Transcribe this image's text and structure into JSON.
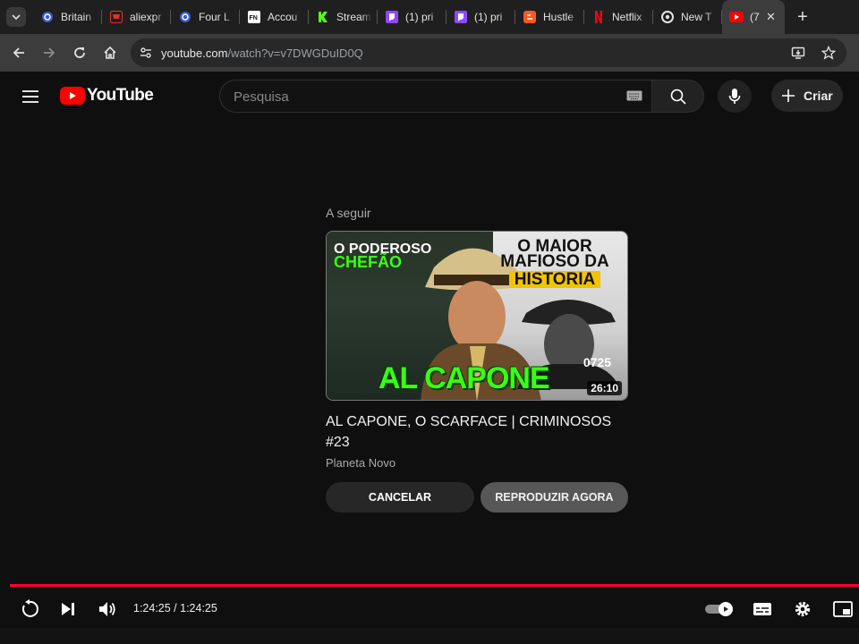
{
  "browser": {
    "tabs": [
      {
        "title": "Britain",
        "icon": "wheel-icon",
        "color": "#9ab8ff"
      },
      {
        "title": "aliexpr",
        "icon": "cart-icon",
        "color": "#e43225"
      },
      {
        "title": "Four L",
        "icon": "wheel-icon",
        "color": "#9ab8ff"
      },
      {
        "title": "Accou",
        "icon": "fn-icon",
        "color": "#ffffff"
      },
      {
        "title": "Stream",
        "icon": "kick-icon",
        "color": "#53fc18"
      },
      {
        "title": "(1) pri",
        "icon": "twitch-icon",
        "color": "#9146ff"
      },
      {
        "title": "(1) pri",
        "icon": "twitch-icon",
        "color": "#9146ff"
      },
      {
        "title": "Hustle",
        "icon": "blogger-icon",
        "color": "#ff5722"
      },
      {
        "title": "Netflix",
        "icon": "netflix-icon",
        "color": "#e50914"
      },
      {
        "title": "New T",
        "icon": "chrome-icon",
        "color": "#e3e3e3"
      }
    ],
    "active_tab": {
      "title": "(7",
      "icon": "youtube-icon"
    },
    "url_host": "youtube.com",
    "url_path": "/watch?v=v7DWGDuID0Q"
  },
  "youtube": {
    "logo_text": "YouTube",
    "search_placeholder": "Pesquisa",
    "create_label": "Criar"
  },
  "upnext": {
    "label": "A seguir",
    "thumbnail": {
      "top_left_line1": "O PODEROSO",
      "top_left_line2": "CHEFÃO",
      "top_right_line1": "O MAIOR",
      "top_right_line2": "MAFIOSO DA",
      "top_right_line3": "HISTORIA",
      "main_text": "AL CAPONE",
      "dates": "0725",
      "duration": "26:10"
    },
    "title": "AL CAPONE, O SCARFACE | CRIMINOSOS #23",
    "channel": "Planeta Novo",
    "cancel_label": "CANCELAR",
    "play_label": "REPRODUZIR AGORA"
  },
  "player": {
    "progress": 1.0,
    "time_display": "1:24:25 / 1:24:25",
    "accent_color": "#ff0033"
  }
}
